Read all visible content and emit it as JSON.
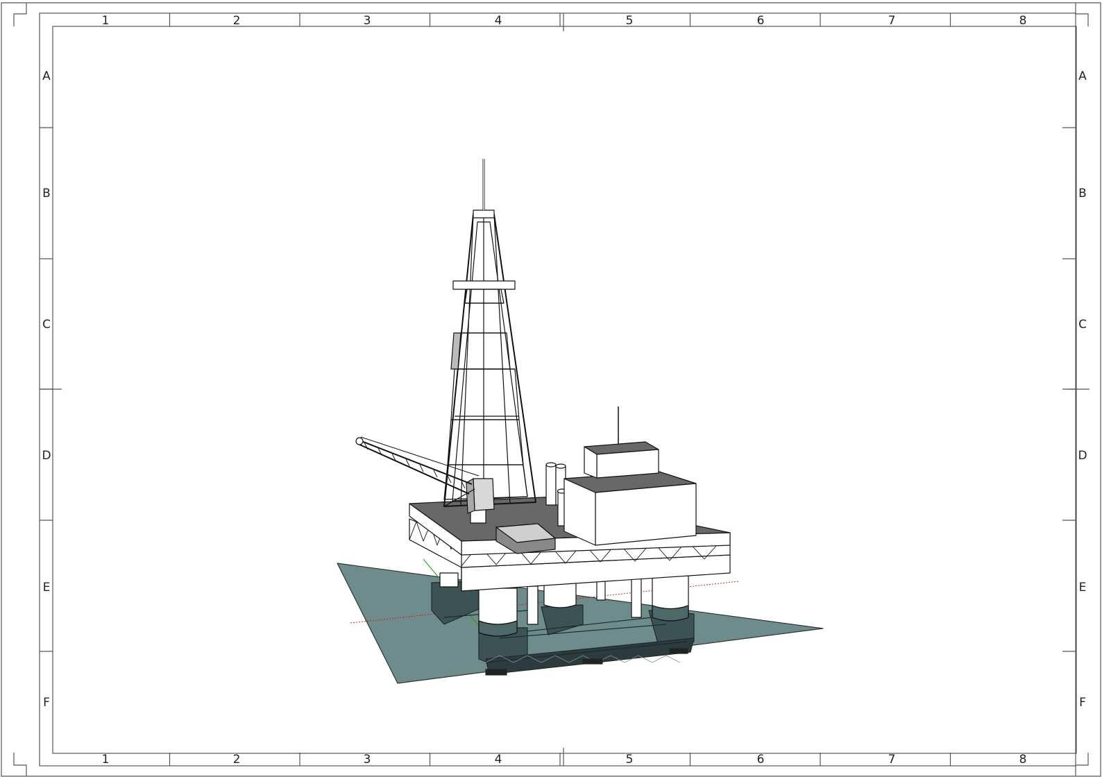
{
  "frame": {
    "columns": [
      "1",
      "2",
      "3",
      "4",
      "5",
      "6",
      "7",
      "8"
    ],
    "rows": [
      "A",
      "B",
      "C",
      "D",
      "E",
      "F"
    ]
  },
  "colors": {
    "water": "#6f8c8c",
    "deck_dark": "#686868",
    "line": "#111111",
    "pontoon": "#3d5252",
    "x_axis": "#d02020",
    "y_axis": "#20a020"
  },
  "drawing": {
    "subject": "offshore-drilling-platform",
    "view": "isometric"
  }
}
